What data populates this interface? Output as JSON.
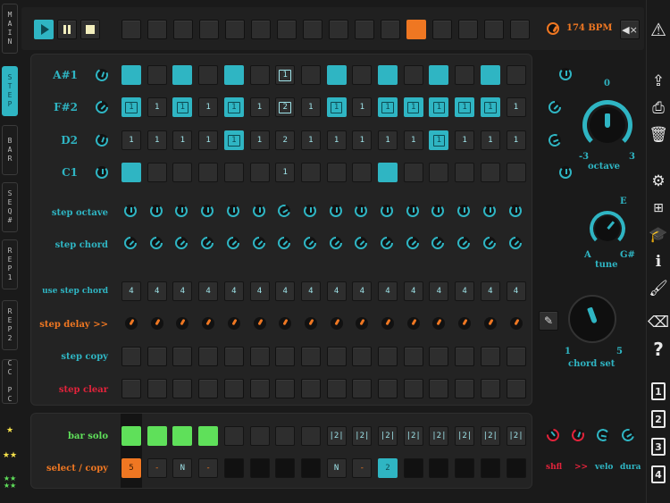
{
  "side_tabs": [
    {
      "label": "MAIN",
      "active": false
    },
    {
      "label": "STEP",
      "active": true
    },
    {
      "label": "BAR",
      "active": false
    },
    {
      "label": "SEQ#",
      "active": false
    },
    {
      "label": "REP1",
      "active": false
    },
    {
      "label": "REP2",
      "active": false
    },
    {
      "label": "CC PC",
      "active": false
    }
  ],
  "transport": {
    "play_icon": "play-icon",
    "pause_icon": "pause-icon",
    "stop_icon": "stop-icon",
    "bpm": "174 BPM",
    "mute_icon": "speaker-mute-icon",
    "active_step": 11
  },
  "rows": [
    {
      "note": "A#1",
      "cells": [
        "on",
        "",
        "on",
        "",
        "on",
        "",
        "[1]",
        "",
        "on",
        "",
        "on",
        "",
        "on",
        "",
        "on",
        ""
      ]
    },
    {
      "note": "F#2",
      "cells": [
        "on1",
        "1",
        "on1",
        "1",
        "on1",
        "1",
        "[2]",
        "1",
        "on1",
        "1",
        "on1",
        "on1",
        "on1",
        "on1",
        "on1",
        "1"
      ]
    },
    {
      "note": "D2",
      "cells": [
        "1",
        "1",
        "1",
        "1",
        "on1",
        "1",
        "2",
        "1",
        "1",
        "1",
        "1",
        "1",
        "on1",
        "1",
        "1",
        "1"
      ]
    },
    {
      "note": "C1",
      "cells": [
        "on",
        "",
        "",
        "",
        "",
        "",
        "1",
        "",
        "",
        "",
        "on",
        "",
        "",
        "",
        "",
        ""
      ]
    }
  ],
  "labels": {
    "step_octave": "step octave",
    "step_chord": "step chord",
    "use_step_chord": "use step chord",
    "step_delay": "step delay >>",
    "step_copy": "step copy",
    "step_clear": "step clear",
    "bar_solo": "bar solo",
    "select_copy": "select / copy"
  },
  "use_step_chord_values": [
    "4",
    "4",
    "4",
    "4",
    "4",
    "4",
    "4",
    "4",
    "4",
    "4",
    "4",
    "4",
    "4",
    "4",
    "4",
    "4"
  ],
  "bar_solo": [
    "green",
    "green",
    "green",
    "green",
    "",
    "",
    "",
    "",
    "|2|",
    "|2|",
    "|2|",
    "|2|",
    "|2|",
    "|2|",
    "|2|",
    "|2|"
  ],
  "select_copy": [
    "5",
    "-",
    "N",
    "-",
    "",
    "",
    "",
    "",
    "N",
    "-",
    "2",
    "",
    "",
    "",
    "",
    ""
  ],
  "right": {
    "octave_label": "octave",
    "octave_top": "0",
    "octave_min": "-3",
    "octave_max": "3",
    "tune_label": "tune",
    "tune_top": "E",
    "tune_min": "A",
    "tune_max": "G#",
    "chord_set_label": "chord set",
    "chord_min": "1",
    "chord_max": "5",
    "pencil_icon": "pencil-icon"
  },
  "bottom_right": {
    "shfl": "shfl",
    "arrows": ">>",
    "velo": "velo",
    "dura": "dura"
  },
  "right_icons": [
    "warning-icon",
    "load-icon",
    "save-icon",
    "trash-icon",
    "settings-icon",
    "hierarchy-icon",
    "graduation-cap-icon",
    "info-icon",
    "brush-icon",
    "eraser-icon",
    "help-icon",
    "clipboard-1-icon",
    "clipboard-2-icon",
    "clipboard-3-icon",
    "clipboard-4-icon"
  ],
  "clip_numbers": [
    "1",
    "2",
    "3",
    "4"
  ],
  "accent": "#2fb5c3",
  "accent_orange": "#ef7722",
  "accent_red": "#e2233b",
  "accent_green": "#5fe05a"
}
